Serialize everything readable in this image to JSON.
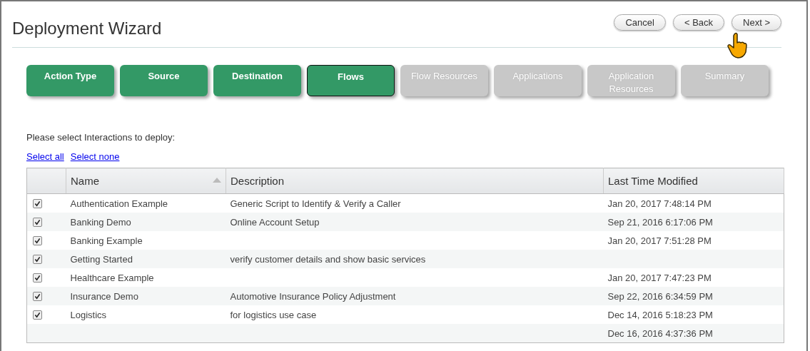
{
  "title": "Deployment Wizard",
  "buttons": [
    {
      "label": "Cancel"
    },
    {
      "label": "< Back"
    },
    {
      "label": "Next >"
    }
  ],
  "steps": [
    {
      "label": "Action Type",
      "completed": true,
      "selected": false
    },
    {
      "label": "Source",
      "completed": true,
      "selected": false
    },
    {
      "label": "Destination",
      "completed": true,
      "selected": false
    },
    {
      "label": "Flows",
      "completed": true,
      "selected": true
    },
    {
      "label": "Flow Resources",
      "completed": false,
      "selected": false
    },
    {
      "label": "Applications",
      "completed": false,
      "selected": false
    },
    {
      "label": "Application Resources",
      "completed": false,
      "selected": false
    },
    {
      "label": "Summary",
      "completed": false,
      "selected": false
    }
  ],
  "instruction": "Please select Interactions to deploy:",
  "links": [
    {
      "label": "Select all"
    },
    {
      "label": "Select none"
    }
  ],
  "table": {
    "columns": [
      {
        "sorted": false
      },
      {
        "label": "Name",
        "sorted": true
      },
      {
        "label": "Description",
        "sorted": false
      },
      {
        "label": "Last Time Modified",
        "sorted": false
      }
    ],
    "rows": [
      {
        "checked": true,
        "name": "Authentication Example",
        "description": "Generic Script to Identify & Verify a Caller",
        "modified": "Jan 20, 2017 7:48:14 PM"
      },
      {
        "checked": true,
        "name": "Banking Demo",
        "description": "Online Account Setup",
        "modified": "Sep 21, 2016 6:17:06 PM"
      },
      {
        "checked": true,
        "name": "Banking Example",
        "modified": "Jan 20, 2017 7:51:28 PM"
      },
      {
        "checked": true,
        "name": "Getting Started",
        "description": "verify customer details and show basic services"
      },
      {
        "checked": true,
        "name": "Healthcare Example",
        "modified": "Jan 20, 2017 7:47:23 PM"
      },
      {
        "checked": true,
        "name": "Insurance Demo",
        "description": "Automotive Insurance Policy Adjustment",
        "modified": "Sep 22, 2016 6:34:59 PM"
      },
      {
        "checked": true,
        "name": "Logistics",
        "description": "for logistics use case",
        "modified": "Dec 14, 2016 5:18:23 PM"
      },
      {
        "modified": "Dec 16, 2016 4:37:36 PM"
      }
    ]
  }
}
